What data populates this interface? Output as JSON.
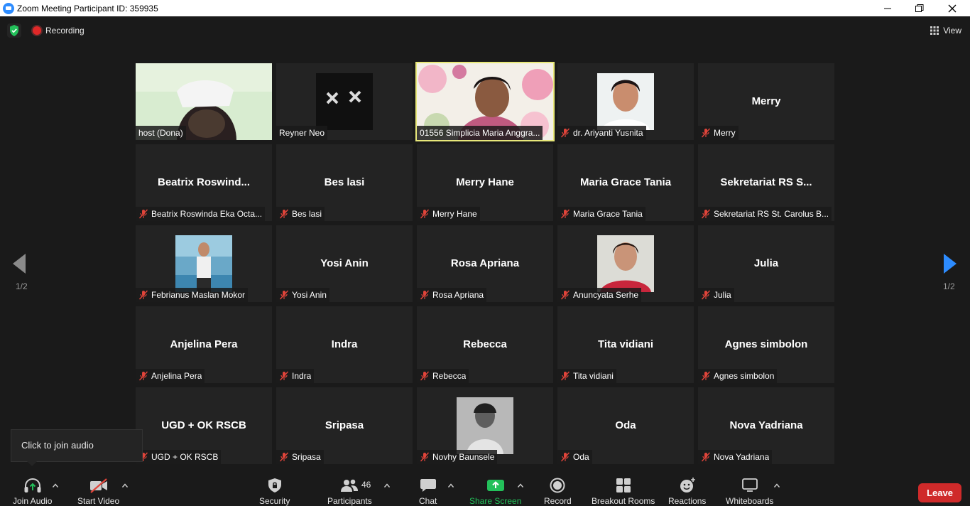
{
  "window": {
    "title": "Zoom Meeting Participant ID: 359935",
    "controls": [
      "minimize",
      "maximize",
      "close"
    ]
  },
  "topbar": {
    "recording_label": "Recording",
    "view_label": "View"
  },
  "colors": {
    "background": "#1a1a1a",
    "tile": "#232323",
    "active_speaker": "#e8e87a",
    "leave": "#cf2a2a",
    "accent": "#2D8CFF",
    "share_green": "#23c05a",
    "mute_red": "#e0443a"
  },
  "pagination": {
    "left_page": "1/2",
    "right_page": "1/2"
  },
  "participants": [
    {
      "label": "host (Dona)",
      "display": "",
      "video": "nurse",
      "muted": false,
      "active": false
    },
    {
      "label": "Reyner Neo",
      "display": "",
      "video": "dark-x",
      "muted": false,
      "active": false
    },
    {
      "label": "01556 Simplicia Maria Anggra...",
      "display": "",
      "video": "floral",
      "muted": false,
      "active": true
    },
    {
      "label": "dr. Ariyanti Yusnita",
      "display": "",
      "video": "photo-white",
      "muted": true,
      "active": false
    },
    {
      "label": "Merry",
      "display": "Merry",
      "video": "",
      "muted": true,
      "active": false
    },
    {
      "label": "Beatrix Roswinda Eka Octa...",
      "display": "Beatrix  Roswind...",
      "video": "",
      "muted": true,
      "active": false
    },
    {
      "label": "Bes lasi",
      "display": "Bes lasi",
      "video": "",
      "muted": true,
      "active": false
    },
    {
      "label": "Merry Hane",
      "display": "Merry Hane",
      "video": "",
      "muted": true,
      "active": false
    },
    {
      "label": "Maria Grace Tania",
      "display": "Maria Grace Tania",
      "video": "",
      "muted": true,
      "active": false
    },
    {
      "label": "Sekretariat RS St. Carolus B...",
      "display": "Sekretariat  RS  S...",
      "video": "",
      "muted": true,
      "active": false
    },
    {
      "label": "Febrianus Maslan Mokor",
      "display": "",
      "video": "photo-blue",
      "muted": true,
      "active": false
    },
    {
      "label": "Yosi Anin",
      "display": "Yosi Anin",
      "video": "",
      "muted": true,
      "active": false
    },
    {
      "label": "Rosa Apriana",
      "display": "Rosa Apriana",
      "video": "",
      "muted": true,
      "active": false
    },
    {
      "label": "Anuncyata Serhe",
      "display": "",
      "video": "photo-red",
      "muted": true,
      "active": false
    },
    {
      "label": "Julia",
      "display": "Julia",
      "video": "",
      "muted": true,
      "active": false
    },
    {
      "label": "Anjelina Pera",
      "display": "Anjelina Pera",
      "video": "",
      "muted": true,
      "active": false
    },
    {
      "label": "Indra",
      "display": "Indra",
      "video": "",
      "muted": true,
      "active": false
    },
    {
      "label": "Rebecca",
      "display": "Rebecca",
      "video": "",
      "muted": true,
      "active": false
    },
    {
      "label": "Tita vidiani",
      "display": "Tita vidiani",
      "video": "",
      "muted": true,
      "active": false
    },
    {
      "label": "Agnes simbolon",
      "display": "Agnes simbolon",
      "video": "",
      "muted": true,
      "active": false
    },
    {
      "label": "UGD + OK RSCB",
      "display": "UGD + OK RSCB",
      "video": "",
      "muted": true,
      "active": false
    },
    {
      "label": "Sripasa",
      "display": "Sripasa",
      "video": "",
      "muted": true,
      "active": false
    },
    {
      "label": "Novhy Baunsele",
      "display": "",
      "video": "photo-bw",
      "muted": true,
      "active": false
    },
    {
      "label": "Oda",
      "display": "Oda",
      "video": "",
      "muted": true,
      "active": false
    },
    {
      "label": "Nova Yadriana",
      "display": "Nova Yadriana",
      "video": "",
      "muted": true,
      "active": false
    }
  ],
  "tooltip": "Click to join audio",
  "toolbar": {
    "join_audio": "Join Audio",
    "start_video": "Start Video",
    "security": "Security",
    "participants": "Participants",
    "participants_count": "46",
    "chat": "Chat",
    "share_screen": "Share Screen",
    "record": "Record",
    "breakout_rooms": "Breakout Rooms",
    "reactions": "Reactions",
    "whiteboards": "Whiteboards",
    "leave": "Leave"
  }
}
